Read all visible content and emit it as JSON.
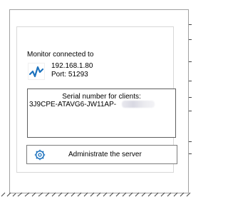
{
  "monitor": {
    "title": "Monitor connected to",
    "ip": "192.168.1.80",
    "port": "Port: 51293",
    "icon": "monitor-icon",
    "accent": "#1e73be"
  },
  "serial": {
    "label": "Serial number for clients:",
    "value": "3J9CPE-ATAVG6-JW11AP-"
  },
  "admin": {
    "label": "Administrate the server",
    "icon": "gear-icon",
    "accent": "#1e73be"
  }
}
